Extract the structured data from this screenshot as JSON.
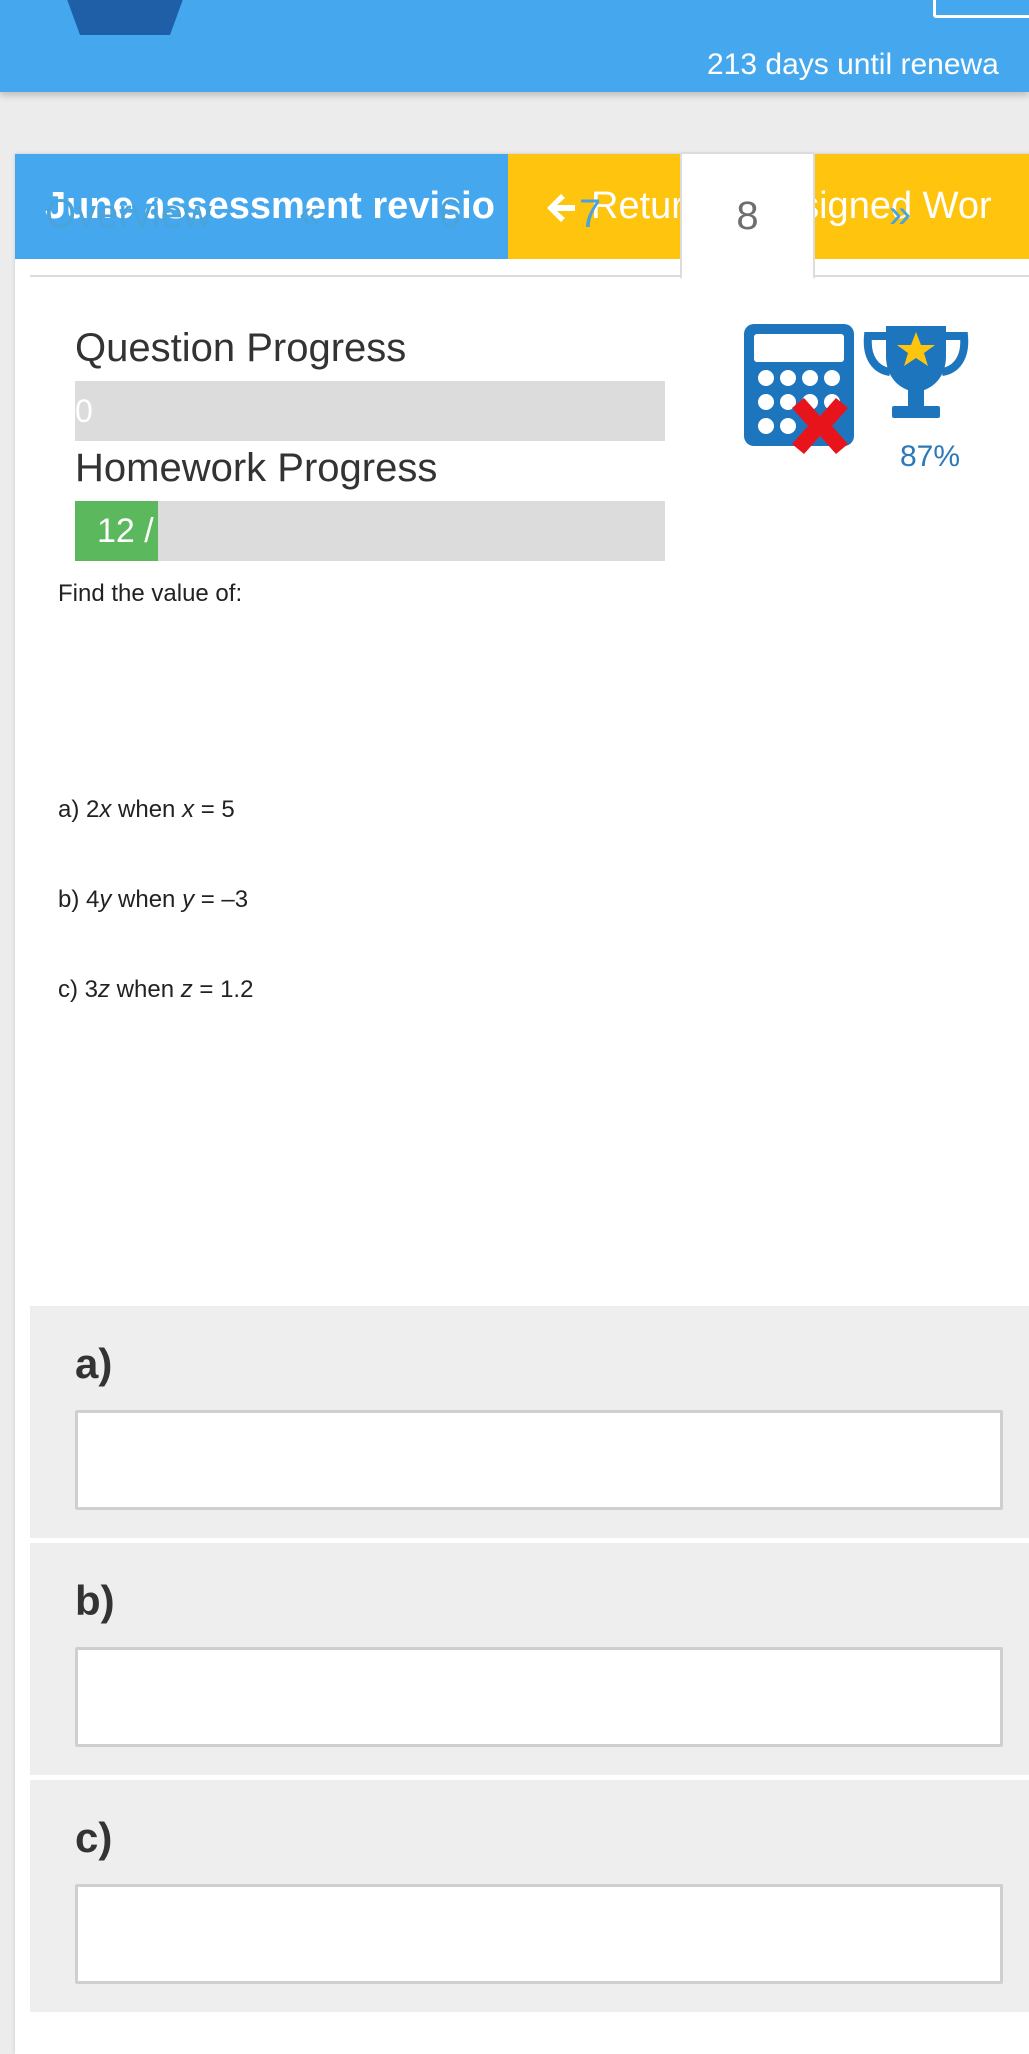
{
  "topbar": {
    "renewal_text": "213 days until renewa"
  },
  "header": {
    "title": "June assessment revisio",
    "return_label": "Return to Assigned Wor"
  },
  "tabs": [
    {
      "label": "Overview",
      "active": false
    },
    {
      "label": "«",
      "active": false
    },
    {
      "label": "6",
      "active": false
    },
    {
      "label": "7",
      "active": false
    },
    {
      "label": "8",
      "active": true
    },
    {
      "label": "»",
      "active": false
    }
  ],
  "progress": {
    "question_label": "Question Progress",
    "question_value": "0",
    "question_fraction": 0,
    "homework_label": "Homework Progress",
    "homework_value": "12 /",
    "homework_fraction": 0.14
  },
  "badges": {
    "calculator": "calculator-not-allowed-icon",
    "trophy": "trophy-icon",
    "score": "87%"
  },
  "colors": {
    "brand_blue": "#45a8ee",
    "return_yellow": "#fec40e",
    "progress_green": "#5cb85c",
    "icon_blue": "#1d76bd",
    "cross_red": "#e8141c"
  },
  "question": {
    "intro": "Find the value of:",
    "parts": [
      {
        "prefix": "a) 2",
        "var1": "x",
        "mid": " when ",
        "var2": "x",
        "suffix": " = 5"
      },
      {
        "prefix": "b) 4",
        "var1": "y",
        "mid": " when ",
        "var2": "y",
        "suffix": " = –3"
      },
      {
        "prefix": "c) 3",
        "var1": "z",
        "mid": " when ",
        "var2": "z",
        "suffix": " = 1.2"
      }
    ]
  },
  "answers": [
    {
      "label": "a)",
      "value": ""
    },
    {
      "label": "b)",
      "value": ""
    },
    {
      "label": "c)",
      "value": ""
    }
  ]
}
